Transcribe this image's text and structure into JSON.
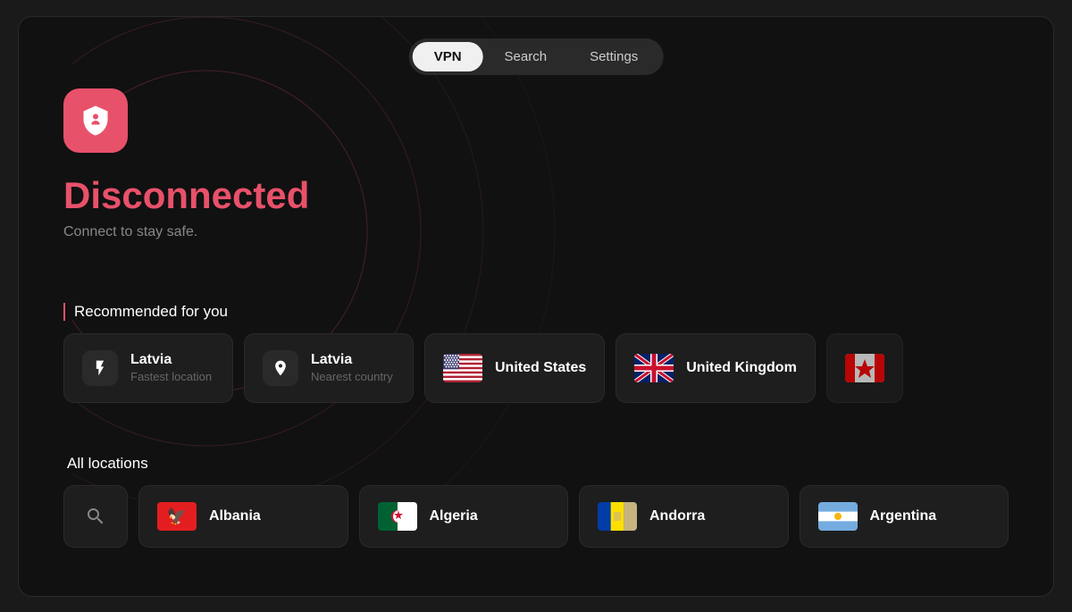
{
  "nav": {
    "tabs": [
      {
        "label": "VPN",
        "active": true
      },
      {
        "label": "Search",
        "active": false
      },
      {
        "label": "Settings",
        "active": false
      }
    ]
  },
  "status": {
    "title": "Disconnected",
    "subtitle": "Connect to stay safe."
  },
  "recommended": {
    "section_label": "Recommended for you",
    "cards": [
      {
        "name": "Latvia",
        "sub": "Fastest location",
        "type": "lightning"
      },
      {
        "name": "Latvia",
        "sub": "Nearest country",
        "type": "pin"
      },
      {
        "name": "United States",
        "sub": "",
        "type": "flag-us"
      },
      {
        "name": "United Kingdom",
        "sub": "",
        "type": "flag-gb"
      },
      {
        "name": "",
        "sub": "",
        "type": "flag-ca",
        "partial": true
      }
    ]
  },
  "all_locations": {
    "section_label": "All locations",
    "items": [
      {
        "name": "search",
        "type": "search"
      },
      {
        "name": "Albania",
        "type": "flag-al"
      },
      {
        "name": "Algeria",
        "type": "flag-dz"
      },
      {
        "name": "Andorra",
        "type": "flag-ad"
      },
      {
        "name": "Argentina",
        "type": "flag-ar"
      }
    ]
  },
  "colors": {
    "accent": "#e8516a",
    "bg": "#111111",
    "card_bg": "#1e1e1e",
    "text_primary": "#ffffff",
    "text_secondary": "#888888"
  }
}
